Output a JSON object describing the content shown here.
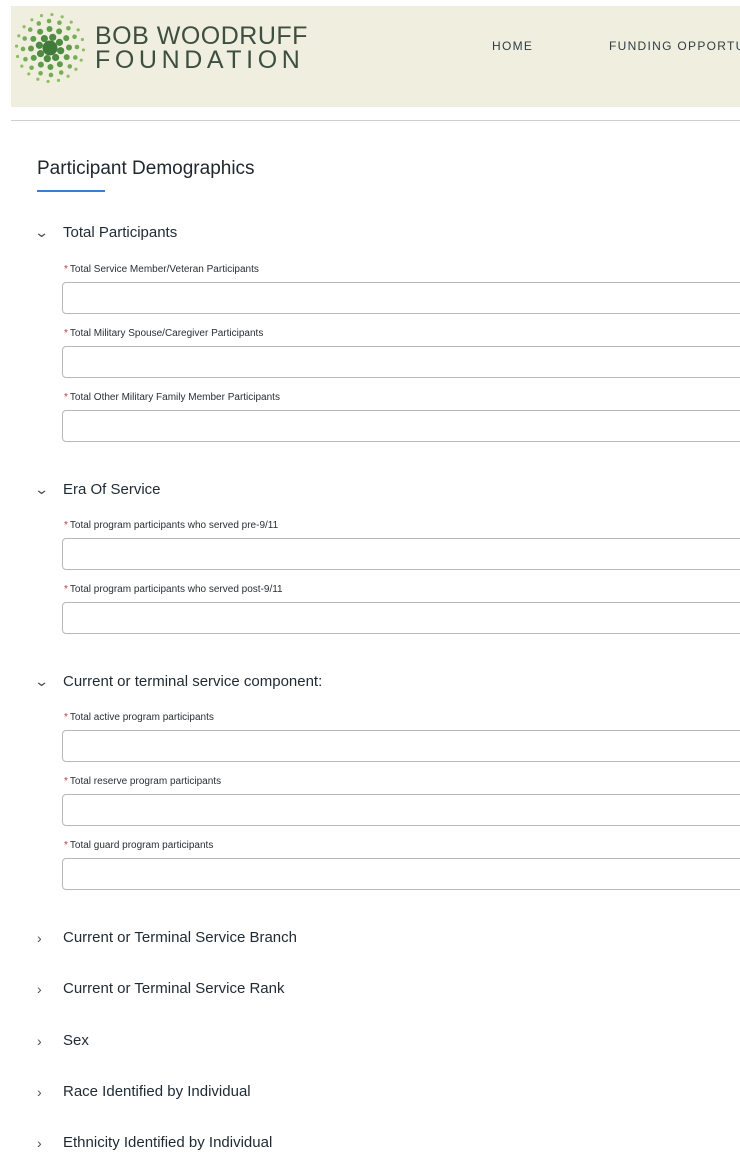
{
  "header": {
    "brand_line1": "BOB WOODRUFF",
    "brand_line2": "FOUNDATION",
    "logo_icon": "dot-burst-logo-icon",
    "nav": [
      "HOME",
      "FUNDING OPPORTU"
    ],
    "background": "#f0eedf",
    "brand_color": "#3d4f3f"
  },
  "page": {
    "title": "Participant Demographics",
    "accent_color": "#3b7bd9",
    "required_marker": "*"
  },
  "sections": [
    {
      "label": "Total Participants",
      "expanded": true,
      "fields": [
        {
          "label": "Total Service Member/Veteran Participants",
          "value": ""
        },
        {
          "label": "Total Military Spouse/Caregiver Participants",
          "value": ""
        },
        {
          "label": "Total Other Military Family Member Participants",
          "value": ""
        }
      ]
    },
    {
      "label": "Era Of Service",
      "expanded": true,
      "fields": [
        {
          "label": "Total program participants who served pre-9/11",
          "value": ""
        },
        {
          "label": "Total program participants who served post-9/11",
          "value": ""
        }
      ]
    },
    {
      "label": "Current or terminal service component:",
      "expanded": true,
      "fields": [
        {
          "label": "Total active program participants",
          "value": ""
        },
        {
          "label": "Total reserve program participants",
          "value": ""
        },
        {
          "label": "Total guard program participants",
          "value": ""
        }
      ]
    },
    {
      "label": "Current or Terminal Service Branch",
      "expanded": false
    },
    {
      "label": "Current or Terminal Service Rank",
      "expanded": false
    },
    {
      "label": "Sex",
      "expanded": false
    },
    {
      "label": "Race Identified by Individual",
      "expanded": false
    },
    {
      "label": "Ethnicity Identified by Individual",
      "expanded": false
    }
  ]
}
